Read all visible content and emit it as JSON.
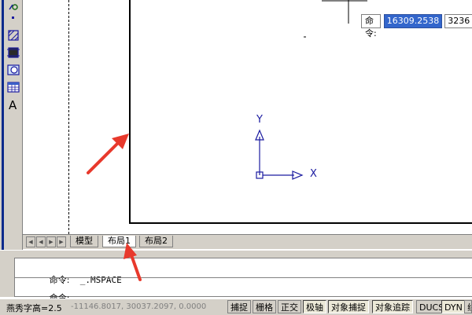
{
  "dynamic_input": {
    "label": "命令:",
    "value": "16309.2538",
    "value2": "3236"
  },
  "ucs_icon": {
    "y_label": "Y",
    "x_label": "X"
  },
  "tabs": [
    {
      "label": "模型",
      "active": false
    },
    {
      "label": "布局1",
      "active": true
    },
    {
      "label": "布局2",
      "active": false
    }
  ],
  "command": {
    "line1_label": "命令:",
    "line1_text": "_.MSPACE",
    "line2_label": "命令:"
  },
  "status": {
    "left_text": "燕秀字高=2.5",
    "coordinates": "-11146.8017, 30037.2097, 0.0000",
    "buttons": [
      "捕捉",
      "栅格",
      "正交",
      "极轴",
      "对象捕捉",
      "对象追踪",
      "DUCS",
      "DYN",
      "线"
    ]
  },
  "colors": {
    "accent_blue": "#3366cc",
    "annotation_red": "#e8392c",
    "ucs_blue": "#1a1aa0"
  },
  "icons": {
    "toolbar": [
      "modify-icon",
      "point-icon",
      "hatch-icon",
      "gradient-icon",
      "region-icon",
      "table-icon",
      "text-icon"
    ]
  }
}
